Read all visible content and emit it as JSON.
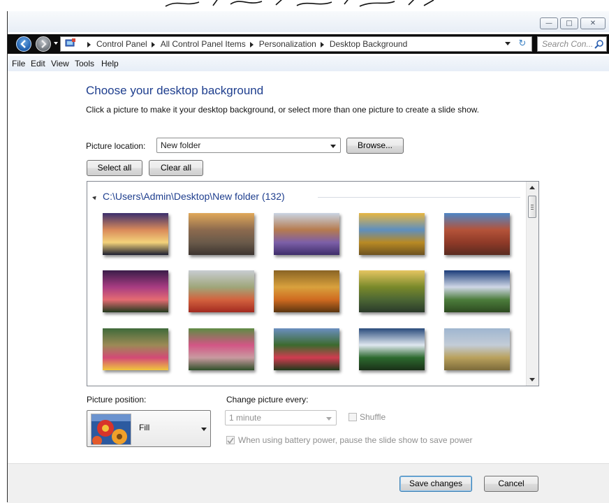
{
  "address": {
    "crumbs": [
      "Control Panel",
      "All Control Panel Items",
      "Personalization",
      "Desktop Background"
    ],
    "search_placeholder": "Search Con..."
  },
  "menu": [
    "File",
    "Edit",
    "View",
    "Tools",
    "Help"
  ],
  "page": {
    "title": "Choose your desktop background",
    "description": "Click a picture to make it your desktop background, or select more than one picture to create a slide show."
  },
  "location": {
    "label": "Picture location:",
    "value": "New folder",
    "browse_label": "Browse..."
  },
  "selection": {
    "select_all": "Select all",
    "clear_all": "Clear all"
  },
  "gallery": {
    "group_title": "C:\\Users\\Admin\\Desktop\\New folder (132)",
    "thumbnails": [
      {
        "name": "sunset-lagoon",
        "colors": [
          "#3b2f6d",
          "#d98a5a",
          "#f3d27a",
          "#1c1e30"
        ]
      },
      {
        "name": "rocky-sunset",
        "colors": [
          "#e0a85a",
          "#8c6a4e",
          "#6a5a4a",
          "#3d3530"
        ]
      },
      {
        "name": "lavender-field",
        "colors": [
          "#c9d4e3",
          "#b67b4f",
          "#7c5fa8",
          "#3e2d6a"
        ]
      },
      {
        "name": "autumn-lake",
        "colors": [
          "#e7b642",
          "#5e8fbf",
          "#b98a24",
          "#6d5220"
        ]
      },
      {
        "name": "red-canyon",
        "colors": [
          "#4d86c6",
          "#b4533a",
          "#8f3a28",
          "#5a2b20"
        ]
      },
      {
        "name": "purple-dusk",
        "colors": [
          "#3a1d49",
          "#a83c82",
          "#e46b72",
          "#223a1e"
        ]
      },
      {
        "name": "alpine-lake",
        "colors": [
          "#c8ccd1",
          "#9fa67a",
          "#d3623e",
          "#a22a20"
        ]
      },
      {
        "name": "autumn-forest",
        "colors": [
          "#8a6424",
          "#d9a13d",
          "#cf6a20",
          "#5a3510"
        ]
      },
      {
        "name": "forest-stream",
        "colors": [
          "#e6c561",
          "#79892a",
          "#4c6634",
          "#2a3a2a"
        ]
      },
      {
        "name": "mountain-meadow",
        "colors": [
          "#1b3c79",
          "#cfd7e6",
          "#4c7d3c",
          "#2d4a20"
        ]
      },
      {
        "name": "flower-garden",
        "colors": [
          "#3f6a3a",
          "#9c8a56",
          "#d34a76",
          "#f0c73d"
        ]
      },
      {
        "name": "garden-path",
        "colors": [
          "#5e8c44",
          "#d25685",
          "#c99aa0",
          "#30502a"
        ]
      },
      {
        "name": "oak-tree",
        "colors": [
          "#6b8fc0",
          "#3c6a2e",
          "#d03c50",
          "#1e3a1a"
        ]
      },
      {
        "name": "waterfall",
        "colors": [
          "#2a4c7c",
          "#dfe7ef",
          "#2d6a2f",
          "#1a3018"
        ]
      },
      {
        "name": "wheat-field",
        "colors": [
          "#9fb6d0",
          "#c3ccd7",
          "#b9a15d",
          "#7c6a3a"
        ]
      }
    ]
  },
  "position": {
    "label": "Picture position:",
    "value": "Fill"
  },
  "interval": {
    "label": "Change picture every:",
    "value": "1 minute",
    "shuffle_label": "Shuffle",
    "battery_label": "When using battery power, pause the slide show to save power"
  },
  "footer": {
    "save_label": "Save changes",
    "cancel_label": "Cancel"
  },
  "colors": {
    "accent": "#1e3e8e",
    "window_chrome": "#0c0c0c"
  }
}
